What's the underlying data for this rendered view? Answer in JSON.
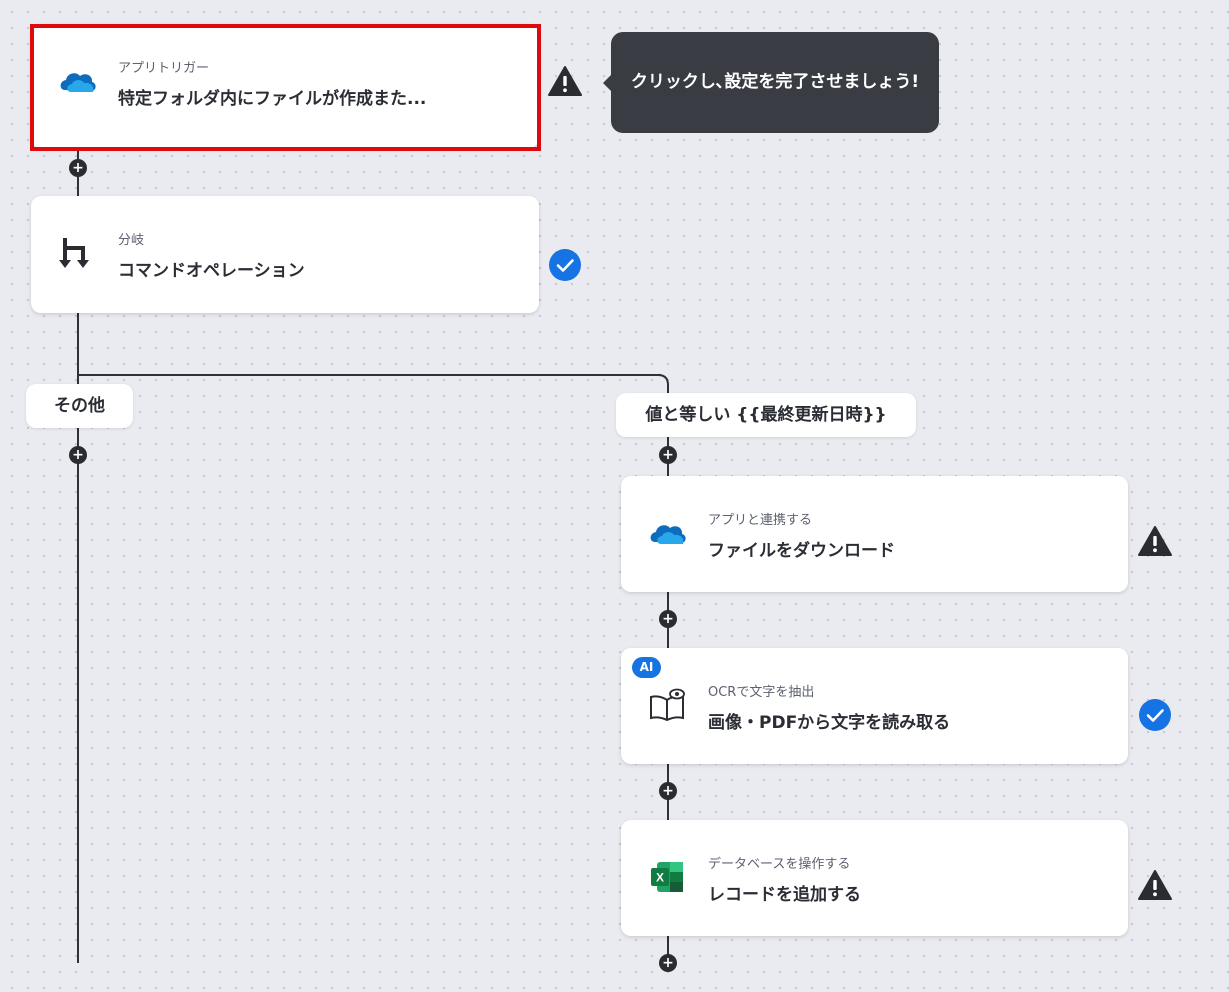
{
  "tooltip": {
    "text": "クリックし､設定を完了させましょう!"
  },
  "steps": [
    {
      "id": "trigger",
      "subtitle": "アプリトリガー",
      "title": "特定フォルダ内にファイルが作成また...",
      "icon": "onedrive-icon",
      "status": "warning",
      "selected": true
    },
    {
      "id": "branch",
      "subtitle": "分岐",
      "title": "コマンドオペレーション",
      "icon": "branch-icon",
      "status": "complete"
    },
    {
      "id": "download",
      "subtitle": "アプリと連携する",
      "title": "ファイルをダウンロード",
      "icon": "onedrive-icon",
      "status": "warning"
    },
    {
      "id": "ocr",
      "subtitle": "OCRで文字を抽出",
      "title": "画像・PDFから文字を読み取る",
      "icon": "ocr-book-eye-icon",
      "status": "complete",
      "badge": "AI"
    },
    {
      "id": "excel",
      "subtitle": "データベースを操作する",
      "title": "レコードを追加する",
      "icon": "excel-icon",
      "status": "warning"
    }
  ],
  "branches": {
    "other": {
      "label": "その他"
    },
    "condition": {
      "label": "値と等しい {{最終更新日時}}"
    }
  },
  "colors": {
    "accent_blue": "#1673e3",
    "selection_red": "#dd0b0b",
    "tooltip_bg": "#393c43",
    "warning": "#2a2c31"
  }
}
